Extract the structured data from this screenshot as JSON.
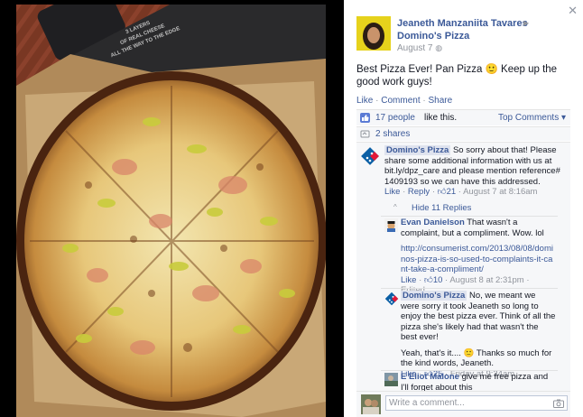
{
  "post": {
    "author": "Jeaneth Manzaniita Tavares",
    "target": "Domino's Pizza",
    "date": "August 7",
    "text": "Best Pizza Ever! Pan Pizza 🙂 Keep up the good work guys!",
    "actions": {
      "like": "Like",
      "comment": "Comment",
      "share": "Share",
      "sep": " · "
    },
    "likes": {
      "count": "17 people",
      "suffix": "like this."
    },
    "top_comments": "Top Comments ▾",
    "shares": "2 shares"
  },
  "box_text": [
    "3 LAYERS",
    "OF REAL CHEESE",
    "ALL THE WAY TO THE EDGE"
  ],
  "comments": [
    {
      "name": "Domino's Pizza",
      "text": "So sorry about that! Please share some additional information with us at bit.ly/dpz_care and please mention reference# 1409193 so we can have this addressed.",
      "like": "Like",
      "reply": "Reply",
      "likes": "21",
      "time": "August 7 at 8:16am"
    }
  ],
  "hide_replies": {
    "chevron": "^",
    "label": "Hide 11 Replies"
  },
  "replies": [
    {
      "name": "Evan Danielson",
      "text": "That wasn't a complaint, but a compliment. Wow. lol",
      "url": "http://consumerist.com/2013/08/08/dominos-pizza-is-so-used-to-complaints-it-cant-take-a-compliment/",
      "like": "Like",
      "likes": "10",
      "time": "August 8 at 2:31pm",
      "edited": "Edited"
    },
    {
      "name": "Domino's Pizza",
      "text": "No, we meant we were sorry it took Jeaneth so long to enjoy the best pizza ever. Think of all the pizza she's likely had that wasn't the best ever!",
      "text2": "Yeah, that's it.... 🙂 Thanks so much for the kind words, Jeaneth.",
      "like": "Like",
      "likes": "25",
      "time": "Friday at 9:34am"
    },
    {
      "name": "E Eliot Malone",
      "text": "give me free pizza and I'll forget about this"
    }
  ],
  "composer": {
    "placeholder": "Write a comment..."
  },
  "icons": {
    "close": "close-icon",
    "privacy": "globe-icon",
    "like": "thumbs-up-icon",
    "share": "share-icon",
    "camera": "camera-icon"
  },
  "colors": {
    "link": "#3b5998",
    "meta": "#90949c",
    "panel_bg": "#f6f7f9"
  }
}
